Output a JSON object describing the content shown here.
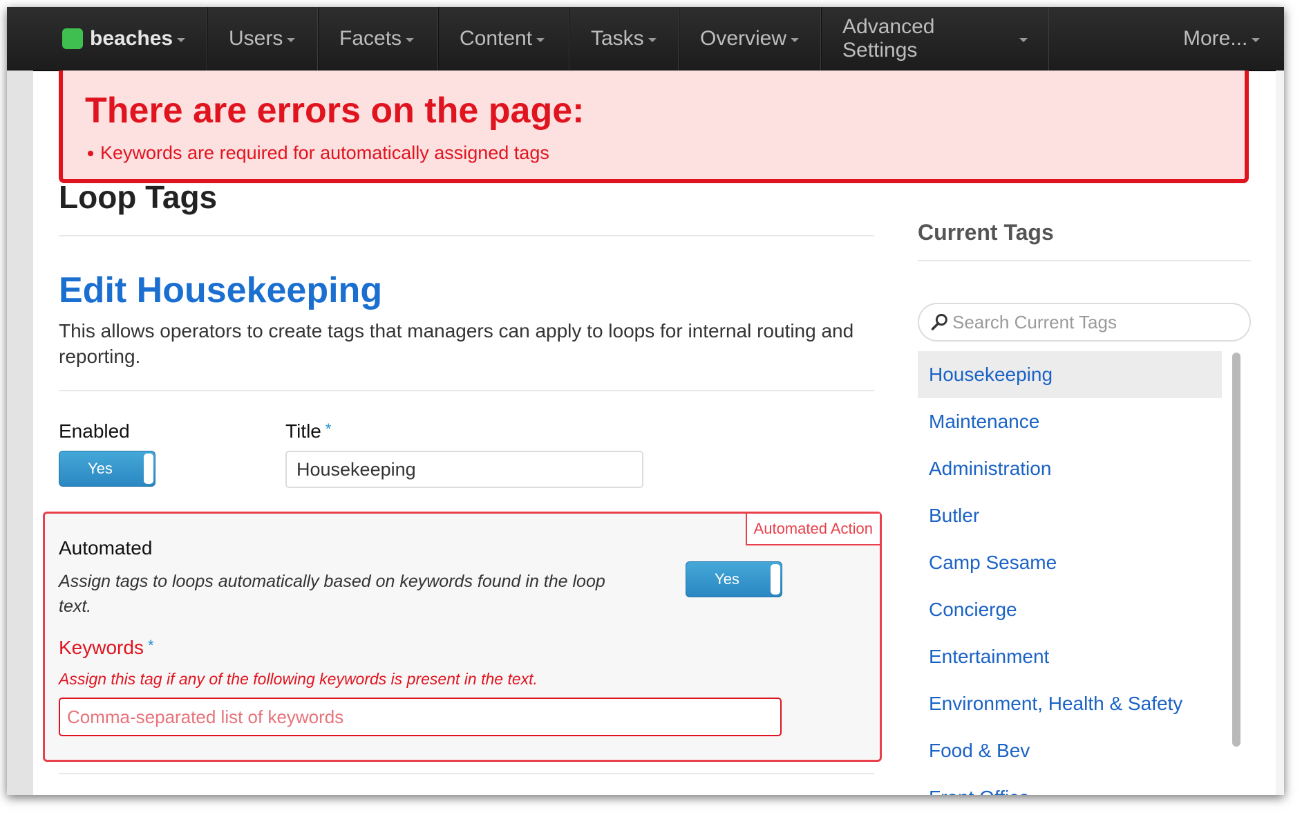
{
  "navbar": {
    "brand": "beaches",
    "items": [
      {
        "label": "Users"
      },
      {
        "label": "Facets"
      },
      {
        "label": "Content"
      },
      {
        "label": "Tasks"
      },
      {
        "label": "Overview"
      },
      {
        "label": "Advanced Settings"
      },
      {
        "label": "More..."
      }
    ]
  },
  "error": {
    "title": "There are errors on the page:",
    "items": [
      "Keywords are required for automatically assigned tags"
    ]
  },
  "page": {
    "heading": "Loop Tags",
    "edit_title": "Edit Housekeeping",
    "description": "This allows operators to create tags that managers can apply to loops for internal routing and reporting."
  },
  "form": {
    "enabled_label": "Enabled",
    "enabled_value": "Yes",
    "title_label": "Title",
    "required_mark": "*",
    "title_value": "Housekeeping",
    "automated_tab": "Automated Action",
    "automated_label": "Automated",
    "automated_desc": "Assign tags to loops automatically based on keywords found in the loop text.",
    "automated_value": "Yes",
    "keywords_label": "Keywords",
    "keywords_desc": "Assign this tag if any of the following keywords is present in the text.",
    "keywords_placeholder": "Comma-separated list of keywords"
  },
  "sidebar": {
    "title": "Current Tags",
    "search_placeholder": "Search Current Tags",
    "tags": [
      {
        "label": "Housekeeping"
      },
      {
        "label": "Maintenance"
      },
      {
        "label": "Administration"
      },
      {
        "label": "Butler"
      },
      {
        "label": "Camp Sesame"
      },
      {
        "label": "Concierge"
      },
      {
        "label": "Entertainment"
      },
      {
        "label": "Environment, Health & Safety"
      },
      {
        "label": "Food & Bev"
      },
      {
        "label": "Front Office"
      }
    ]
  },
  "colors": {
    "error": "#e0141f",
    "link": "#1a62c5",
    "toggle": "#2b87c2",
    "brand_logo": "#3fbf4f"
  }
}
